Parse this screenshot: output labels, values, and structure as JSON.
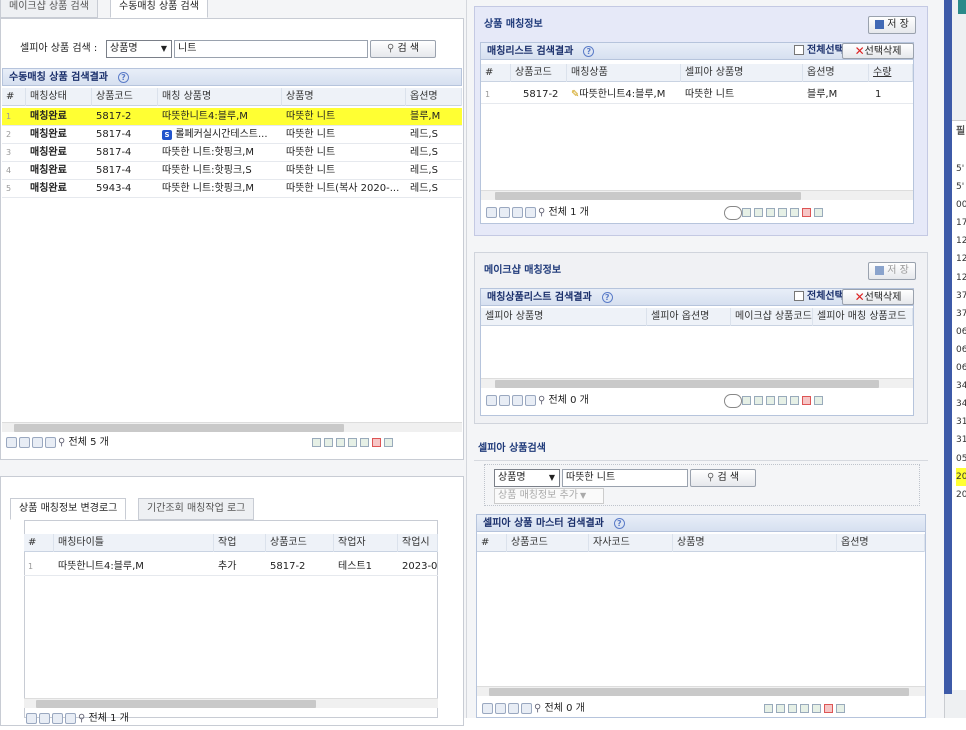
{
  "tabs": {
    "tab1": "메이크샵 상품 검색",
    "tab2": "수동매칭 상품 검색"
  },
  "search": {
    "label": "셀피아 상품 검색 :",
    "select": "상품명",
    "value": "니트",
    "button": "검 색"
  },
  "manual": {
    "title": "수동매칭 상품 검색결과",
    "headers": [
      "#",
      "매칭상태",
      "상품코드",
      "매칭 상품명",
      "상품명",
      "옵션명"
    ],
    "rows": [
      {
        "n": "1",
        "status": "매칭완료",
        "code": "5817-2",
        "mname": "따뜻한니트4:블루,M",
        "pname": "따뜻한 니트",
        "opt": "블루,M",
        "s": false
      },
      {
        "n": "2",
        "status": "매칭완료",
        "code": "5817-4",
        "mname": "롤페커실시간테스트...",
        "pname": "따뜻한 니트",
        "opt": "레드,S",
        "s": true
      },
      {
        "n": "3",
        "status": "매칭완료",
        "code": "5817-4",
        "mname": "따뜻한 니트:핫핑크,M",
        "pname": "따뜻한 니트",
        "opt": "레드,S",
        "s": false
      },
      {
        "n": "4",
        "status": "매칭완료",
        "code": "5817-4",
        "mname": "따뜻한 니트:핫핑크,S",
        "pname": "따뜻한 니트",
        "opt": "레드,S",
        "s": false
      },
      {
        "n": "5",
        "status": "매칭완료",
        "code": "5943-4",
        "mname": "따뜻한 니트:핫핑크,M",
        "pname": "따뜻한 니트(복사 2020-...",
        "opt": "레드,S",
        "s": false
      }
    ],
    "total": "전체 5 개"
  },
  "logtabs": {
    "tab1": "상품 매칭정보 변경로그",
    "tab2": "기간조회 매칭작업 로그"
  },
  "log": {
    "headers": [
      "#",
      "매칭타이틀",
      "작업",
      "상품코드",
      "작업자",
      "작업시"
    ],
    "rows": [
      {
        "n": "1",
        "title": "따뜻한니트4:블루,M",
        "work": "추가",
        "code": "5817-2",
        "user": "테스트1",
        "time": "2023-0"
      }
    ],
    "total": "전체 1 개"
  },
  "match": {
    "title": "상품 매칭정보",
    "save": "저 장",
    "listTitle": "매칭리스트 검색결과",
    "selectAll": "전체선택",
    "deleteSel": "선택삭제",
    "headers": [
      "#",
      "상품코드",
      "매칭상품",
      "셀피아 상품명",
      "옵션명",
      "수량"
    ],
    "rows": [
      {
        "n": "1",
        "code": "5817-2",
        "mp": "따뜻한니트4:블루,M",
        "sp": "따뜻한 니트",
        "opt": "블루,M",
        "qty": "1"
      }
    ],
    "total": "전체 1 개"
  },
  "makeshop": {
    "title": "메이크샵 매칭정보",
    "save": "저 장",
    "listTitle": "매칭상품리스트 검색결과",
    "selectAll": "전체선택",
    "deleteSel": "선택삭제",
    "headers": [
      "셀피아 상품명",
      "셀피아 옵션명",
      "메이크샵 상품코드",
      "셀피아 매칭 상품코드"
    ],
    "total": "전체 0 개"
  },
  "sellpia": {
    "title": "셀피아 상품검색",
    "select": "상품명",
    "value": "따뜻한 니트",
    "button": "검 색",
    "add": "상품 매칭정보 추가",
    "listTitle": "셀피아 상품 마스터 검색결과",
    "headers": [
      "#",
      "상품코드",
      "자사코드",
      "상품명",
      "옵션명"
    ],
    "total": "전체 0 개"
  },
  "edge": {
    "label": "필",
    "cells": [
      "5'",
      "5'",
      "00",
      "17",
      "12",
      "12",
      "12",
      "37",
      "37",
      "06",
      "06",
      "06",
      "34",
      "34",
      "31",
      "31",
      "05",
      "20",
      "20"
    ]
  },
  "colors": {
    "highlight": "#ffff33",
    "accent": "#1a2f6b"
  }
}
